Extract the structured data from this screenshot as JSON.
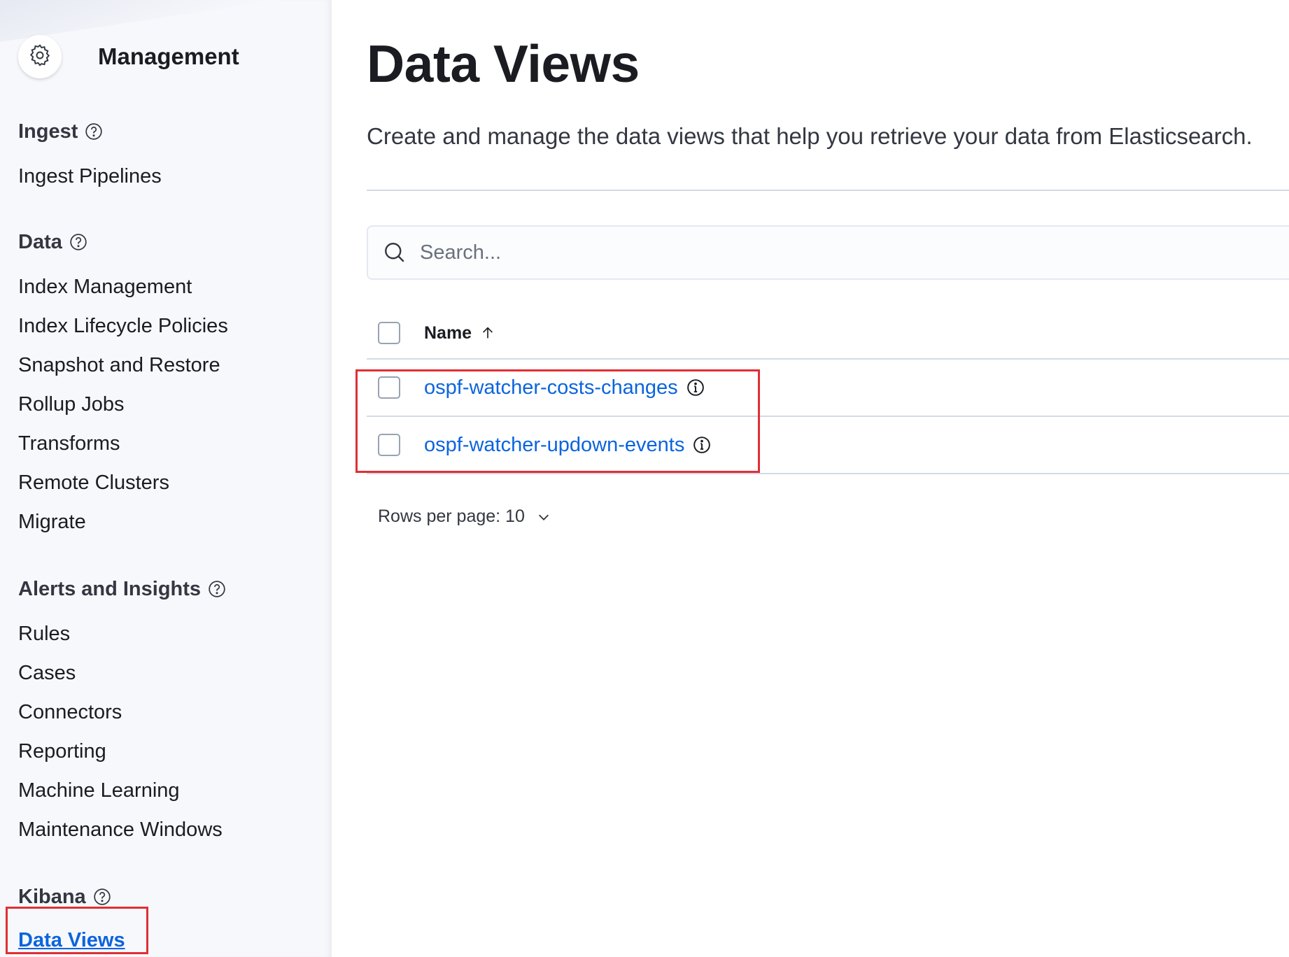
{
  "sidebar": {
    "title": "Management",
    "groups": [
      {
        "title": "Ingest",
        "items": [
          "Ingest Pipelines"
        ]
      },
      {
        "title": "Data",
        "items": [
          "Index Management",
          "Index Lifecycle Policies",
          "Snapshot and Restore",
          "Rollup Jobs",
          "Transforms",
          "Remote Clusters",
          "Migrate"
        ]
      },
      {
        "title": "Alerts and Insights",
        "items": [
          "Rules",
          "Cases",
          "Connectors",
          "Reporting",
          "Machine Learning",
          "Maintenance Windows"
        ]
      },
      {
        "title": "Kibana",
        "items": [
          "Data Views"
        ]
      }
    ],
    "active_item": "Data Views"
  },
  "main": {
    "title": "Data Views",
    "description": "Create and manage the data views that help you retrieve your data from Elasticsearch.",
    "search": {
      "placeholder": "Search...",
      "value": ""
    },
    "table": {
      "header": "Name",
      "sort": "ascending",
      "rows": [
        "ospf-watcher-costs-changes",
        "ospf-watcher-updown-events"
      ]
    },
    "pagination": {
      "label": "Rows per page: 10"
    }
  },
  "annotations": {
    "highlight_color": "#e02f35"
  },
  "colors": {
    "link": "#0b64dd",
    "text": "#1a1c21",
    "sidebar_bg": "#f7f8fc"
  },
  "icons": [
    "gear-icon",
    "help-icon",
    "search-icon",
    "sort-up-arrow-icon",
    "info-icon",
    "chevron-down-icon"
  ]
}
